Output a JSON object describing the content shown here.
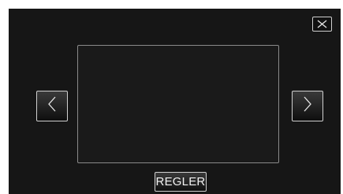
{
  "screen": {
    "icons": {
      "close": "close-icon",
      "previous": "chevron-left-icon",
      "next": "chevron-right-icon"
    },
    "adjust_button_label": "REGLER",
    "colors": {
      "background": "#161616",
      "button_border": "#d0d0d0",
      "frame_border": "#8a8a8a"
    }
  }
}
